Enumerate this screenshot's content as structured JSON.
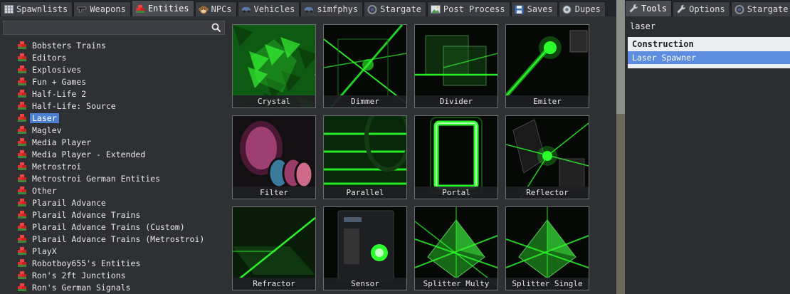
{
  "left_tabs": [
    {
      "label": "Spawnlists",
      "icon": "grid-icon",
      "active": false
    },
    {
      "label": "Weapons",
      "icon": "gun-icon",
      "active": false
    },
    {
      "label": "Entities",
      "icon": "bricks-icon",
      "active": true
    },
    {
      "label": "NPCs",
      "icon": "monkey-icon",
      "active": false
    },
    {
      "label": "Vehicles",
      "icon": "car-icon",
      "active": false
    },
    {
      "label": "simfphys",
      "icon": "car-icon",
      "active": false
    },
    {
      "label": "Stargate",
      "icon": "stargate-icon",
      "active": false
    },
    {
      "label": "Post Process",
      "icon": "picture-icon",
      "active": false
    },
    {
      "label": "Saves",
      "icon": "disk-icon",
      "active": false
    },
    {
      "label": "Dupes",
      "icon": "dupe-icon",
      "active": false
    }
  ],
  "right_tabs": [
    {
      "label": "Tools",
      "icon": "wrench-icon",
      "active": true
    },
    {
      "label": "Options",
      "icon": "wrench-icon",
      "active": false
    },
    {
      "label": "Stargate",
      "icon": "stargate-icon",
      "active": false
    }
  ],
  "search": {
    "value": "",
    "icon": "search-icon"
  },
  "categories": [
    "Bobsters Trains",
    "Editors",
    "Explosives",
    "Fun + Games",
    "Half-Life 2",
    "Half-Life: Source",
    "Laser",
    "Maglev",
    "Media Player",
    "Media Player - Extended",
    "Metrostroi",
    "Metrostroi German Entities",
    "Other",
    "Plarail Advance",
    "Plarail Advance Trains",
    "Plarail Advance Trains (Custom)",
    "Plarail Advance Trains (Metrostroi)",
    "PlayX",
    "Robotboy655's Entities",
    "Ron's 2ft Junctions",
    "Ron's German Signals"
  ],
  "selected_category": "Laser",
  "tiles": [
    "Crystal",
    "Dimmer",
    "Divider",
    "Emiter",
    "Filter",
    "Parallel",
    "Portal",
    "Reflector",
    "Refractor",
    "Sensor",
    "Splitter Multy",
    "Splitter Single"
  ],
  "tool_search": {
    "value": "laser"
  },
  "tool_results": {
    "group": "Construction",
    "items": [
      "Laser Spawner"
    ]
  },
  "colors": {
    "accent": "#4b7fd1",
    "laser_green": "#2bff2b"
  }
}
